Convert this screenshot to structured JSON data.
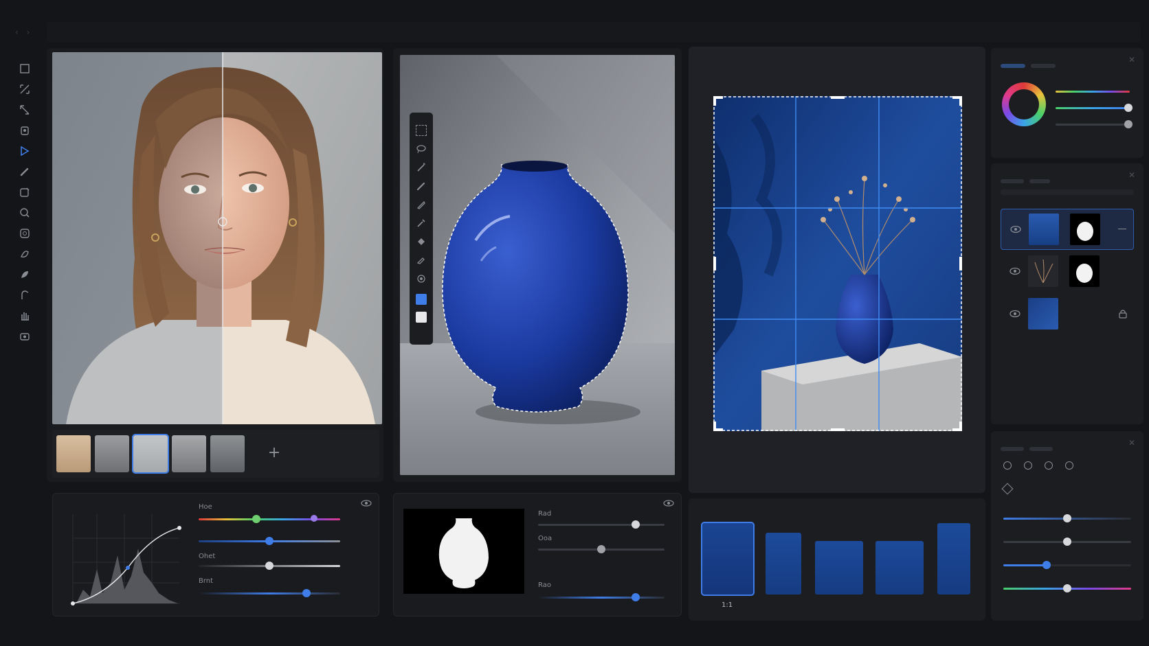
{
  "colors": {
    "accent": "#3f7de8",
    "panel": "#1b1c20",
    "background": "#141518",
    "vase_blue": "#1b3fa8"
  },
  "toolbar": {
    "icons": [
      "crop-icon",
      "transform-icon",
      "perspective-icon",
      "clone-icon",
      "select-icon",
      "brush-icon",
      "frame-icon",
      "zoom-icon",
      "heal-icon",
      "dodge-icon",
      "burn-icon",
      "pen-icon",
      "hand-icon",
      "layer-mask-icon"
    ]
  },
  "portrait": {
    "thumbnails": 5,
    "active_thumbnail": 3,
    "add_label": "+"
  },
  "vase_tools": {
    "icons": [
      "marquee-icon",
      "lasso-icon",
      "magic-wand-icon",
      "brush-icon",
      "pen-icon",
      "eyedropper-icon",
      "bucket-icon",
      "eraser-icon",
      "spot-heal-icon"
    ]
  },
  "curves": {
    "hue_label": "Hoe",
    "hue_value": 0.41,
    "hue_end_value": 0.82,
    "sat_value": 0.5,
    "contrast_label": "Ohet",
    "contrast_value": 0.5,
    "brightness_label": "Brnt",
    "brightness_value": 0.76
  },
  "mask": {
    "red_label": "Rad",
    "red_value": 0.77,
    "green_label": "Ooa",
    "green_value": 0.5,
    "blue_label": "Rao",
    "blue_value": 0.77
  },
  "filmstrip": {
    "active_label": "1:1",
    "frames": 5
  },
  "color_panel": {
    "hue_slider": 0.95,
    "sat_slider": 0.98,
    "light_slider": 0.98
  },
  "layers": {
    "rows": [
      "vase-layer",
      "flowers-layer",
      "background-layer"
    ]
  },
  "adjustments": {
    "slider1": 0.5,
    "slider2": 0.5,
    "slider3": 0.34,
    "slider4": 0.5
  }
}
